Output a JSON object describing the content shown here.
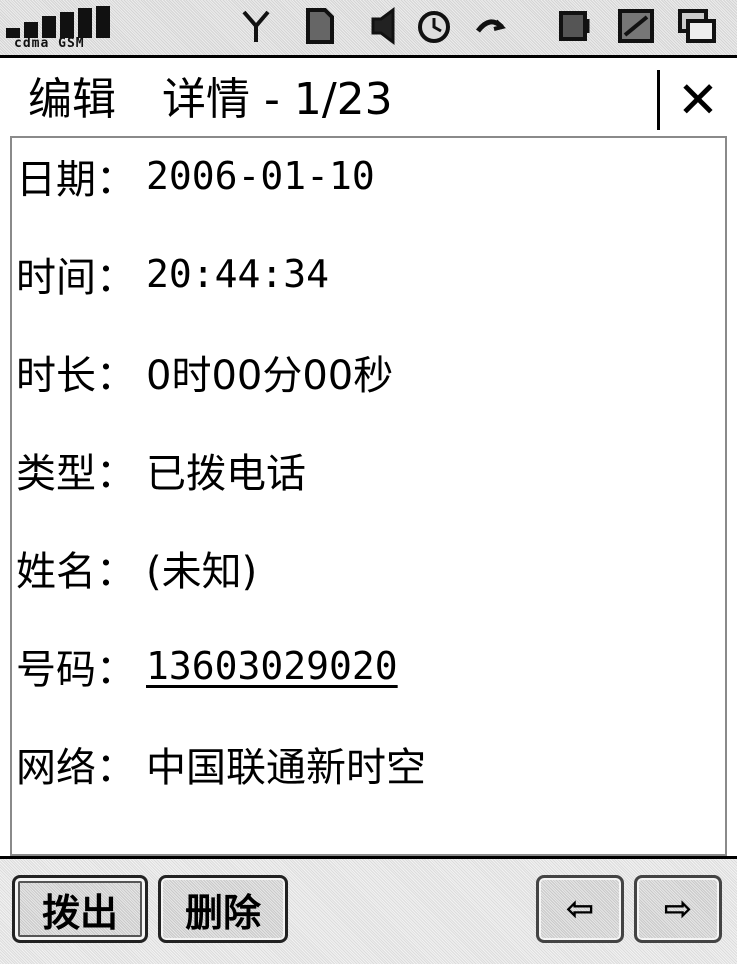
{
  "status_bar": {
    "network_label": "cdma  GSM",
    "icons": [
      "signal-icon",
      "antenna-icon",
      "sim-icon",
      "speaker-icon",
      "alarm-icon",
      "bluetooth-icon",
      "volume-icon",
      "battery-icon",
      "message-icon"
    ]
  },
  "title_bar": {
    "edit_label": "编辑",
    "title": "详情 - 1/23",
    "close_glyph": "✕"
  },
  "details": [
    {
      "key": "date",
      "label": "日期：",
      "value": "2006-01-10"
    },
    {
      "key": "time",
      "label": "时间：",
      "value": "20:44:34"
    },
    {
      "key": "duration",
      "label": "时长：",
      "value": "0时00分00秒"
    },
    {
      "key": "type",
      "label": "类型：",
      "value": "已拨电话"
    },
    {
      "key": "name",
      "label": "姓名：",
      "value": "(未知)"
    },
    {
      "key": "number",
      "label": "号码：",
      "value": "13603029020"
    },
    {
      "key": "network",
      "label": "网络：",
      "value": "中国联通新时空"
    }
  ],
  "toolbar": {
    "dial_label": "拨出",
    "delete_label": "删除",
    "prev_glyph": "⇦",
    "next_glyph": "⇨"
  }
}
